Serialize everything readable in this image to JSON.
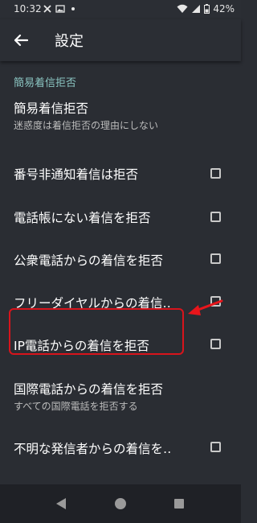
{
  "status_bar": {
    "time": "10:32",
    "battery": "42%",
    "left_icons": [
      "x-icon",
      "picture-icon",
      "notification-dot-icon"
    ],
    "right_icons": [
      "wifi-icon",
      "signal-icon",
      "battery-icon"
    ]
  },
  "app_bar": {
    "back_icon": "back-arrow-icon",
    "title": "設定"
  },
  "section": {
    "header": "簡易着信拒否"
  },
  "rows": [
    {
      "title": "簡易着信拒否",
      "subtitle": "迷惑度は着信拒否の理由にしない",
      "has_checkbox": false,
      "checked": false
    },
    {
      "title": "番号非通知着信は拒否",
      "subtitle": "",
      "has_checkbox": true,
      "checked": false
    },
    {
      "title": "電話帳にない着信を拒否",
      "subtitle": "",
      "has_checkbox": true,
      "checked": false
    },
    {
      "title": "公衆電話からの着信を拒否",
      "subtitle": "",
      "has_checkbox": true,
      "checked": false
    },
    {
      "title": "フリーダイヤルからの着信‥",
      "subtitle": "",
      "has_checkbox": true,
      "checked": false
    },
    {
      "title": "IP電話からの着信を拒否",
      "subtitle": "",
      "has_checkbox": true,
      "checked": false
    },
    {
      "title": "国際電話からの着信を拒否",
      "subtitle": "すべての国際電話を拒否する",
      "has_checkbox": false,
      "checked": false
    },
    {
      "title": "不明な発信者からの着信を‥",
      "subtitle": "",
      "has_checkbox": true,
      "checked": false
    }
  ],
  "annotation": {
    "highlight_color": "#d8141c",
    "arrow_color": "#e8151b"
  },
  "nav_bar": {
    "icons": [
      "nav-back-icon",
      "nav-home-icon",
      "nav-recents-icon"
    ]
  },
  "colors": {
    "background": "#2a2d33",
    "accent": "#8ac4c1",
    "text_primary": "#ffffff",
    "text_secondary": "#bdbdbd"
  }
}
